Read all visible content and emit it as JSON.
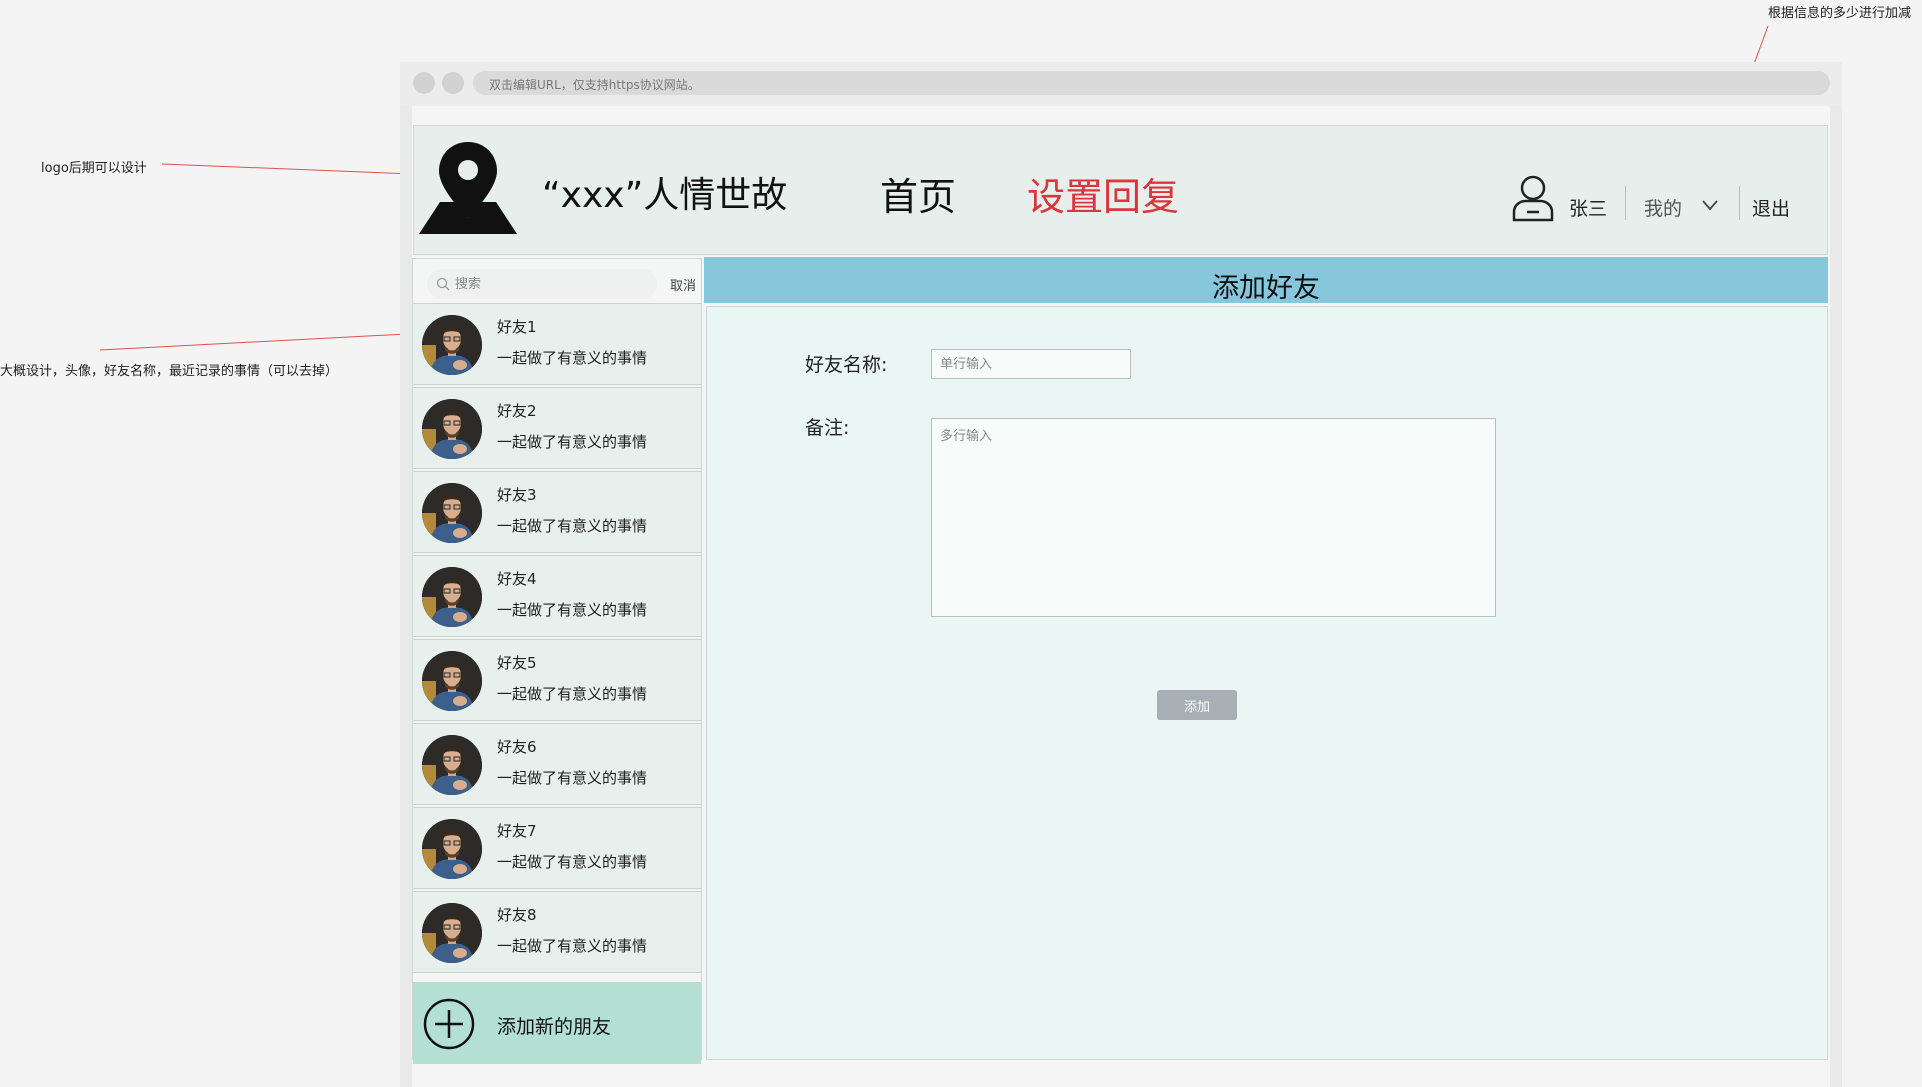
{
  "annotations": {
    "logo_note": "logo后期可以设计",
    "list_note": "大概设计，头像，好友名称，最近记录的事情（可以去掉）",
    "top_note": "根据信息的多少进行加减"
  },
  "browser": {
    "url_hint": "双击编辑URL，仅支持https协议网站。"
  },
  "header": {
    "logo_icon": "map-pin-icon",
    "site_title": "“xxx”人情世故",
    "nav": {
      "home": "首页",
      "reply_settings": "设置回复"
    },
    "user_icon": "user-icon",
    "user_name": "张三",
    "my_menu": "我的",
    "logout": "退出"
  },
  "sidebar": {
    "search_placeholder": "搜索",
    "cancel": "取消",
    "friends": [
      {
        "name": "好友1",
        "note": "一起做了有意义的事情"
      },
      {
        "name": "好友2",
        "note": "一起做了有意义的事情"
      },
      {
        "name": "好友3",
        "note": "一起做了有意义的事情"
      },
      {
        "name": "好友4",
        "note": "一起做了有意义的事情"
      },
      {
        "name": "好友5",
        "note": "一起做了有意义的事情"
      },
      {
        "name": "好友6",
        "note": "一起做了有意义的事情"
      },
      {
        "name": "好友7",
        "note": "一起做了有意义的事情"
      },
      {
        "name": "好友8",
        "note": "一起做了有意义的事情"
      }
    ],
    "add_new_label": "添加新的朋友"
  },
  "main": {
    "title": "添加好友",
    "name_label": "好友名称:",
    "name_placeholder": "单行输入",
    "note_label": "备注:",
    "note_placeholder": "多行输入",
    "add_button": "添加"
  },
  "colors": {
    "accent_red": "#d9363e",
    "title_bar": "#87c7dc",
    "add_new_bg": "#b3e0d3",
    "button_gray": "#a7aeb4"
  }
}
